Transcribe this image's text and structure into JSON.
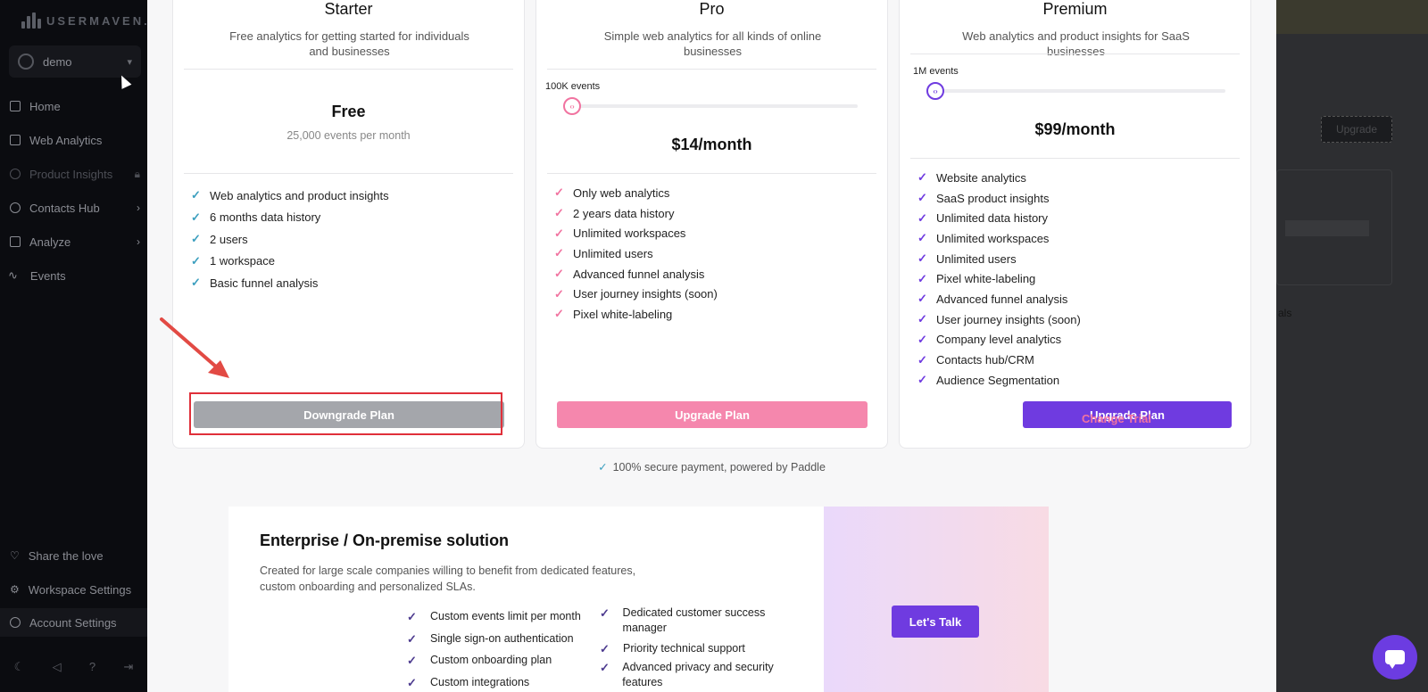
{
  "sidebar": {
    "brand": "USERMAVEN.",
    "workspace": "demo",
    "items": [
      {
        "label": "Home",
        "icon": "home-icon"
      },
      {
        "label": "Web Analytics",
        "icon": "browser-icon"
      },
      {
        "label": "Product Insights",
        "icon": "pie-icon"
      },
      {
        "label": "Contacts Hub",
        "icon": "user-icon"
      },
      {
        "label": "Analyze",
        "icon": "chart-icon"
      },
      {
        "label": "Events",
        "icon": "pulse-icon"
      }
    ],
    "bottom_items": [
      {
        "label": "Share the love",
        "icon": "heart-icon"
      },
      {
        "label": "Workspace Settings",
        "icon": "gear-icon"
      },
      {
        "label": "Account Settings",
        "icon": "user-settings-icon"
      }
    ]
  },
  "background": {
    "upgrade_label": "Upgrade",
    "partial_text": "als"
  },
  "plans": {
    "starter": {
      "title": "Starter",
      "description": "Free analytics for getting started for individuals and businesses",
      "price": "Free",
      "price_sub": "25,000 events per month",
      "features": [
        "Web analytics and product insights",
        "6 months data history",
        "2 users",
        "1 workspace",
        "Basic funnel analysis"
      ],
      "button": "Downgrade Plan",
      "check_color": "#3c9fbf"
    },
    "pro": {
      "title": "Pro",
      "description": "Simple web analytics for all kinds of online businesses",
      "slider_label": "100K events",
      "price": "$14/month",
      "features": [
        "Only web analytics",
        "2 years data history",
        "Unlimited workspaces",
        "Unlimited users",
        "Advanced funnel analysis",
        "User journey insights (soon)",
        "Pixel white-labeling"
      ],
      "button": "Upgrade Plan",
      "check_color": "#f173a0",
      "button_color": "#f587ad"
    },
    "premium": {
      "title": "Premium",
      "description": "Web analytics and product insights for SaaS businesses",
      "slider_label": "1M events",
      "price": "$99/month",
      "features": [
        "Website analytics",
        "SaaS product insights",
        "Unlimited data history",
        "Unlimited workspaces",
        "Unlimited users",
        "Pixel white-labeling",
        "Advanced funnel analysis",
        "User journey insights (soon)",
        "Company level analytics",
        "Contacts hub/CRM",
        "Audience Segmentation"
      ],
      "secondary_button": "Change Trial",
      "button": "Upgrade Plan",
      "check_color": "#6f3be0",
      "button_color": "#6f3be0"
    }
  },
  "secure_note": "100% secure payment, powered by Paddle",
  "enterprise": {
    "title": "Enterprise / On-premise solution",
    "description": "Created for large scale companies willing to benefit from dedicated features, custom onboarding and personalized SLAs.",
    "features_left": [
      "Custom events limit per month",
      "Single sign-on authentication",
      "Custom onboarding plan",
      "Custom integrations"
    ],
    "features_right": [
      "Dedicated customer success manager",
      "Priority technical support",
      "Advanced privacy and security features"
    ],
    "button": "Let's Talk"
  }
}
